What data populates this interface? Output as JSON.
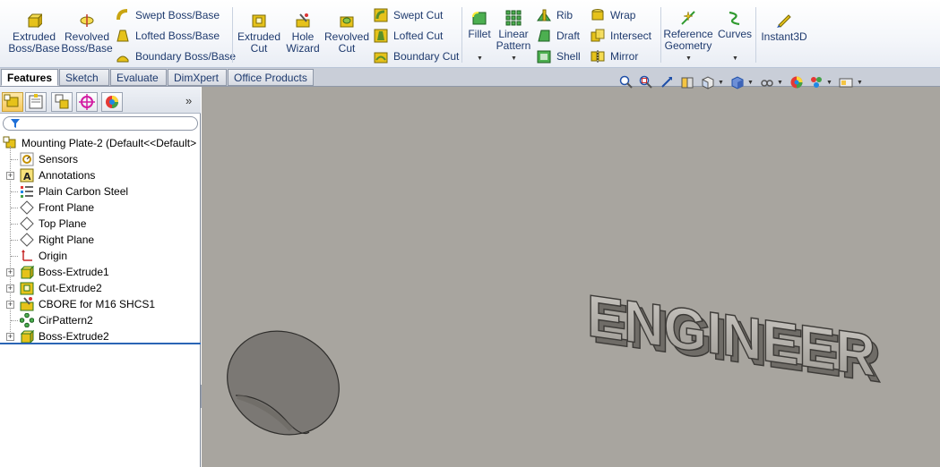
{
  "ribbon": {
    "extruded_boss": "Extruded\nBoss/Base",
    "revolved_boss": "Revolved\nBoss/Base",
    "swept_boss": "Swept Boss/Base",
    "lofted_boss": "Lofted Boss/Base",
    "boundary_boss": "Boundary Boss/Base",
    "extruded_cut": "Extruded\nCut",
    "hole_wizard": "Hole\nWizard",
    "revolved_cut": "Revolved\nCut",
    "swept_cut": "Swept Cut",
    "lofted_cut": "Lofted Cut",
    "boundary_cut": "Boundary Cut",
    "fillet": "Fillet",
    "linear_pattern": "Linear\nPattern",
    "rib": "Rib",
    "draft": "Draft",
    "shell": "Shell",
    "wrap": "Wrap",
    "intersect": "Intersect",
    "mirror": "Mirror",
    "reference_geometry": "Reference\nGeometry",
    "curves": "Curves",
    "instant3d": "Instant3D"
  },
  "tabs": [
    "Features",
    "Sketch",
    "Evaluate",
    "DimXpert",
    "Office Products"
  ],
  "tree": {
    "root": "Mounting Plate-2  (Default<<Default>",
    "items": [
      "Sensors",
      "Annotations",
      "Plain Carbon Steel",
      "Front Plane",
      "Top Plane",
      "Right Plane",
      "Origin",
      "Boss-Extrude1",
      "Cut-Extrude2",
      "CBORE for M16 SHCS1",
      "CirPattern2",
      "Boss-Extrude2"
    ]
  },
  "model": {
    "embossed_text": "ENGINEER"
  },
  "colors": {
    "viewport_bg": "#a8a59f",
    "feature_icon": "#e6c21a",
    "accent_green": "#2f9a2f"
  }
}
